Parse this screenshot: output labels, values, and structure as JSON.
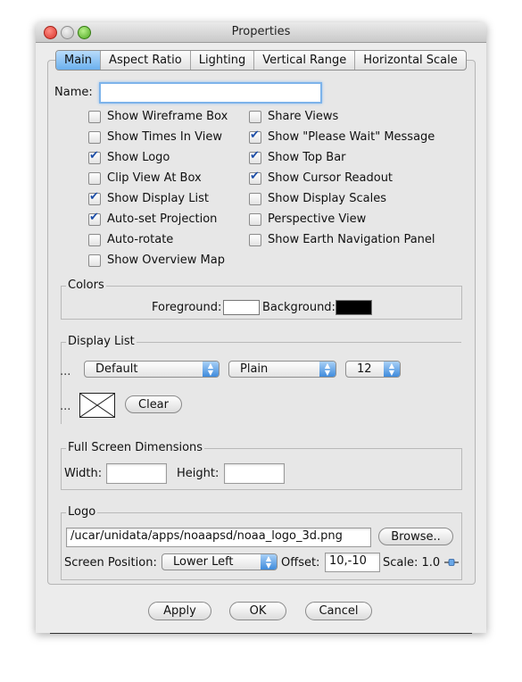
{
  "window": {
    "title": "Properties"
  },
  "tabs": [
    "Main",
    "Aspect Ratio",
    "Lighting",
    "Vertical Range",
    "Horizontal Scale"
  ],
  "name_field": {
    "label": "Name:",
    "value": ""
  },
  "checkboxes_left": [
    {
      "label": "Show Wireframe Box",
      "checked": false
    },
    {
      "label": "Show Times In View",
      "checked": false
    },
    {
      "label": "Show Logo",
      "checked": true
    },
    {
      "label": "Clip View At Box",
      "checked": false
    },
    {
      "label": "Show Display List",
      "checked": true
    },
    {
      "label": "Auto-set Projection",
      "checked": true
    },
    {
      "label": "Auto-rotate",
      "checked": false
    },
    {
      "label": "Show Overview Map",
      "checked": false
    }
  ],
  "checkboxes_right": [
    {
      "label": "Share Views",
      "checked": false
    },
    {
      "label": "Show \"Please Wait\" Message",
      "checked": true
    },
    {
      "label": "Show Top Bar",
      "checked": true
    },
    {
      "label": "Show Cursor Readout",
      "checked": true
    },
    {
      "label": "Show Display Scales",
      "checked": false
    },
    {
      "label": "Perspective View",
      "checked": false
    },
    {
      "label": "Show Earth Navigation Panel",
      "checked": false
    }
  ],
  "colors": {
    "title": "Colors",
    "foreground_label": "Foreground:",
    "background_label": "Background:",
    "foreground_color": "#ffffff",
    "background_color": "#000000"
  },
  "display_list": {
    "title": "Display List",
    "dots": "...",
    "font_value": "Default",
    "style_value": "Plain",
    "size_value": "12",
    "clear_label": "Clear"
  },
  "full_screen": {
    "title": "Full Screen Dimensions",
    "width_label": "Width:",
    "height_label": "Height:",
    "width_value": "",
    "height_value": ""
  },
  "logo": {
    "title": "Logo",
    "path_value": "/ucar/unidata/apps/noaapsd/noaa_logo_3d.png",
    "browse_label": "Browse..",
    "position_label": "Screen Position:",
    "position_value": "Lower Left",
    "offset_label": "Offset:",
    "offset_value": "10,-10",
    "scale_label": "Scale: 1.0"
  },
  "buttons": {
    "apply": "Apply",
    "ok": "OK",
    "cancel": "Cancel"
  }
}
